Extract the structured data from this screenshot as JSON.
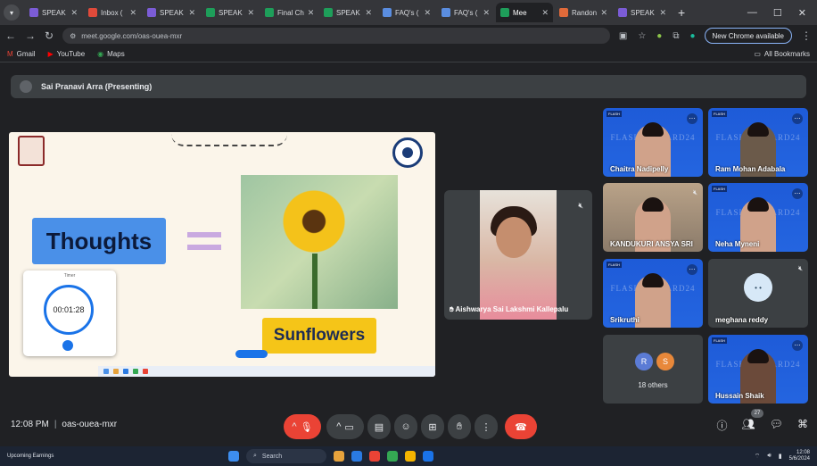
{
  "browser": {
    "tabs": [
      {
        "label": "SPEAK",
        "color": "#7b5cd6"
      },
      {
        "label": "Inbox (",
        "color": "#e04a3a"
      },
      {
        "label": "SPEAK",
        "color": "#7b5cd6"
      },
      {
        "label": "SPEAK",
        "color": "#1e9e5a"
      },
      {
        "label": "Final Ch",
        "color": "#1e9e5a"
      },
      {
        "label": "SPEAK",
        "color": "#1e9e5a"
      },
      {
        "label": "FAQ's (",
        "color": "#5a8de0"
      },
      {
        "label": "FAQ's (",
        "color": "#5a8de0"
      },
      {
        "label": "Mee",
        "color": "#1e9e5a",
        "active": true
      },
      {
        "label": "Randon",
        "color": "#e06a3a"
      },
      {
        "label": "SPEAK",
        "color": "#7b5cd6"
      }
    ],
    "url": "meet.google.com/oas-ouea-mxr",
    "chrome_button": "New Chrome available",
    "bookmarks": [
      "Gmail",
      "YouTube",
      "Maps"
    ],
    "all_bookmarks": "All Bookmarks"
  },
  "meet": {
    "presenting_label": "Sai Pranavi Arra (Presenting)",
    "time": "12:08 PM",
    "meeting_code": "oas-ouea-mxr",
    "participants_badge": "27",
    "slide": {
      "thoughts": "Thoughts",
      "sunflowers": "Sunflowers",
      "timer_title": "Timer",
      "timer_value": "00:01:28"
    },
    "center_participant": "Aishwarya Sai Lakshmi Kallepalu",
    "tiles": [
      {
        "name": "Chaitra Nadipelly",
        "brand": "FLASHFORWARD24"
      },
      {
        "name": "Ram Mohan Adabala",
        "brand": "FLASHFORWARD24"
      },
      {
        "name": "KANDUKURI ANSYA SRI",
        "brand": ""
      },
      {
        "name": "Neha Myneni",
        "brand": "FLASHFORWARD24"
      },
      {
        "name": "Srikruthi",
        "brand": "FLASHFORWARD24"
      },
      {
        "name": "meghana reddy",
        "brand": ""
      },
      {
        "name": "18 others",
        "initials": [
          "R",
          "S"
        ]
      },
      {
        "name": "Hussain Shaik",
        "brand": "FLASHFORWARD24"
      }
    ]
  },
  "taskbar": {
    "weather": "Upcoming Earnings",
    "search": "Search",
    "tray_time": "12:08",
    "tray_date": "5/6/2024"
  }
}
